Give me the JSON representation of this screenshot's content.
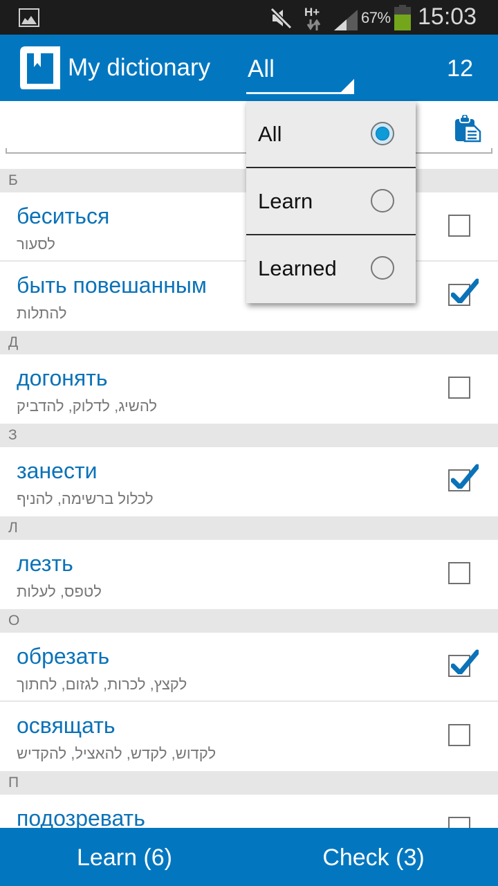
{
  "status_bar": {
    "battery_percent": "67%",
    "battery_level": 0.67,
    "time": "15:03",
    "network_type": "H+",
    "icons": [
      "gallery-icon",
      "mute-icon",
      "network-hplus-icon",
      "signal-icon",
      "battery-icon"
    ]
  },
  "app_bar": {
    "title": "My dictionary",
    "filter_value": "All",
    "word_count": "12",
    "icon": "book-bookmark-icon"
  },
  "search": {
    "value": "",
    "placeholder": "",
    "paste_icon": "clipboard-icon"
  },
  "sections": [
    {
      "letter": "Б",
      "words": [
        {
          "word": "беситься",
          "translation": "לסעור",
          "checked": false
        },
        {
          "word": "быть повешанным",
          "translation": "להתלות",
          "checked": true
        }
      ]
    },
    {
      "letter": "Д",
      "words": [
        {
          "word": "догонять",
          "translation": "להשיג, לדלוק, להדביק",
          "checked": false
        }
      ]
    },
    {
      "letter": "З",
      "words": [
        {
          "word": "занести",
          "translation": "לכלול ברשימה, להניף",
          "checked": true
        }
      ]
    },
    {
      "letter": "Л",
      "words": [
        {
          "word": "лезть",
          "translation": "לטפס, לעלות",
          "checked": false
        }
      ]
    },
    {
      "letter": "О",
      "words": [
        {
          "word": "обрезать",
          "translation": "לקצץ, לכרות, לגזום, לחתוך",
          "checked": true
        },
        {
          "word": "освящать",
          "translation": "לקדוש, לקדש, להאציל, להקדיש",
          "checked": false
        }
      ]
    },
    {
      "letter": "П",
      "words": [
        {
          "word": "подозревать",
          "translation": "",
          "checked": false
        }
      ]
    }
  ],
  "bottom_bar": {
    "learn_label": "Learn (6)",
    "check_label": "Check (3)"
  },
  "dropdown": {
    "options": [
      {
        "label": "All",
        "selected": true
      },
      {
        "label": "Learn",
        "selected": false
      },
      {
        "label": "Learned",
        "selected": false
      }
    ]
  },
  "colors": {
    "primary": "#0277c0",
    "word_text": "#0a72b8",
    "section_bg": "#e6e6e6",
    "status_bar": "#1c1c1c",
    "radio_selected": "#0f9ad8",
    "battery": "#74a61b"
  }
}
